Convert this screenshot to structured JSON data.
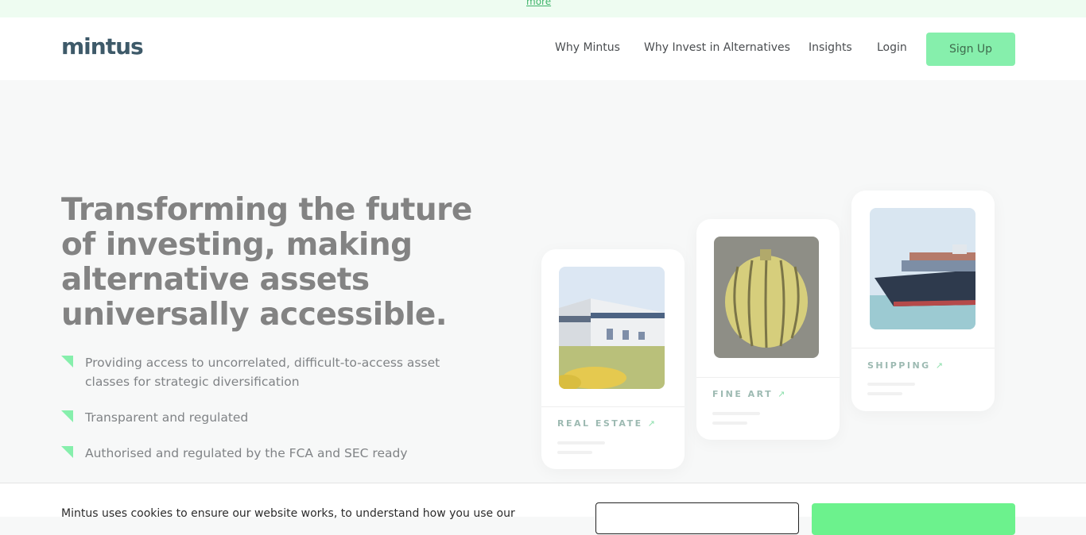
{
  "banner": {
    "link": "more"
  },
  "header": {
    "logo": "mintus",
    "nav": [
      "Why Mintus",
      "Why Invest in Alternatives",
      "Insights",
      "Login"
    ],
    "signup": "Sign Up"
  },
  "hero": {
    "title": "Transforming the future of investing, making alternative assets universally accessible.",
    "bullets": [
      "Providing access to uncorrelated, difficult-to-access asset classes for strategic diversification",
      "Transparent and regulated",
      "Authorised and regulated by the FCA and SEC ready"
    ]
  },
  "cards": [
    {
      "label": "REAL ESTATE",
      "icon": "trend-up-icon"
    },
    {
      "label": "FINE ART",
      "icon": "trend-up-icon"
    },
    {
      "label": "SHIPPING",
      "icon": "trend-up-icon"
    }
  ],
  "cookie": {
    "text": "Mintus uses cookies to ensure our website works, to understand how you use our"
  },
  "colors": {
    "accent": "#86efac",
    "brand": "#3e5a69"
  }
}
